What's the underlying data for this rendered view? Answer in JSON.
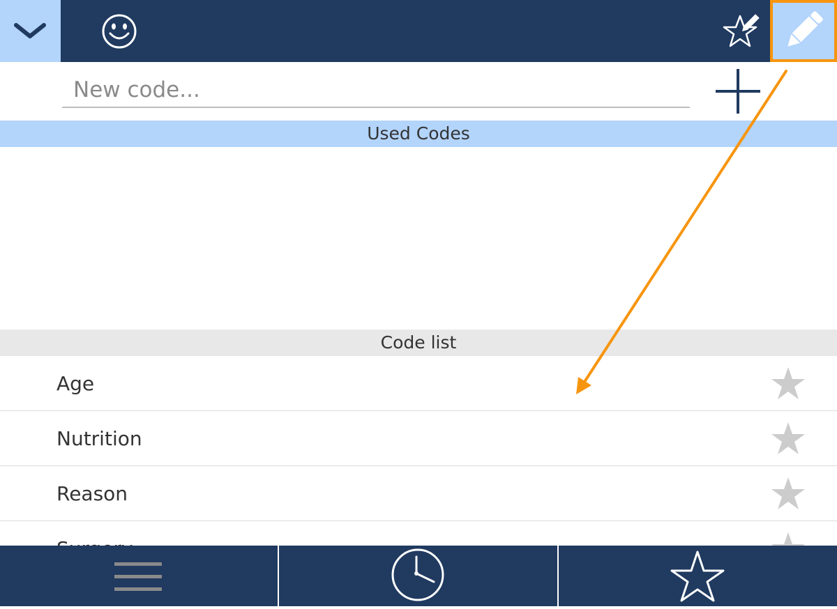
{
  "toolbar": {
    "collapse_icon": "chevron-down-icon",
    "smiley_icon": "smiley-icon",
    "favorite_edit_icon": "star-pencil-icon",
    "edit_icon": "pencil-icon"
  },
  "new_code": {
    "placeholder": "New code...",
    "value": "",
    "add_icon": "plus-icon"
  },
  "sections": {
    "used_codes": "Used Codes",
    "code_list": "Code list"
  },
  "codes": [
    {
      "label": "Age",
      "favorite": false
    },
    {
      "label": "Nutrition",
      "favorite": false
    },
    {
      "label": "Reason",
      "favorite": false
    },
    {
      "label": "Surgery",
      "favorite": false
    }
  ],
  "bottom_nav": {
    "menu_icon": "menu-icon",
    "history_icon": "clock-icon",
    "favorites_icon": "star-icon"
  },
  "colors": {
    "bar_dark": "#203a60",
    "accent_light": "#b3d4fb",
    "highlight_orange": "#f7950f",
    "star_inactive": "#cccccc"
  }
}
